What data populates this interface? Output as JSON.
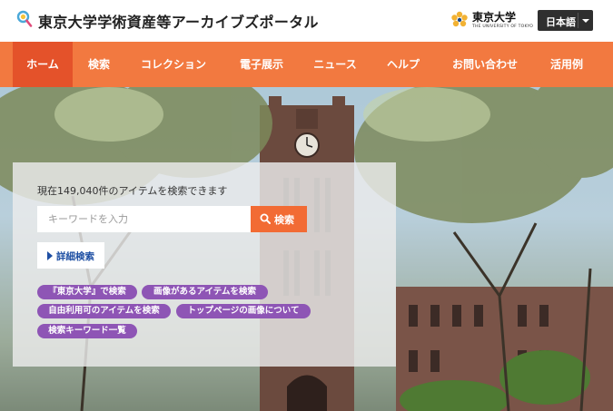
{
  "header": {
    "title": "東京大学学術資産等アーカイブズポータル",
    "university_logo": {
      "name": "東京大学",
      "subtitle": "THE UNIVERSITY OF TOKYO"
    },
    "language": {
      "selected": "日本語"
    }
  },
  "nav": {
    "items": [
      {
        "label": "ホーム",
        "active": true
      },
      {
        "label": "検索"
      },
      {
        "label": "コレクション"
      },
      {
        "label": "電子展示"
      },
      {
        "label": "ニュース"
      },
      {
        "label": "ヘルプ"
      },
      {
        "label": "お問い合わせ"
      },
      {
        "label": "活用例"
      }
    ]
  },
  "search": {
    "count_text": "現在149,040件のアイテムを検索できます",
    "placeholder": "キーワードを入力",
    "value": "",
    "button_label": "検索",
    "advanced_label": "詳細検索",
    "tags": [
      "『東京大学』で検索",
      "画像があるアイテムを検索",
      "自由利用可のアイテムを検索",
      "トップページの画像について",
      "検索キーワード一覧"
    ]
  },
  "colors": {
    "nav_bg": "#f27940",
    "nav_active": "#e4522a",
    "search_button": "#f26b34",
    "tag_bg": "#8e55b5",
    "link_blue": "#1e4fa3"
  },
  "icons": [
    "search-logo-icon",
    "utokyo-seal-icon",
    "chevron-down-icon",
    "search-icon",
    "caret-right-icon"
  ]
}
